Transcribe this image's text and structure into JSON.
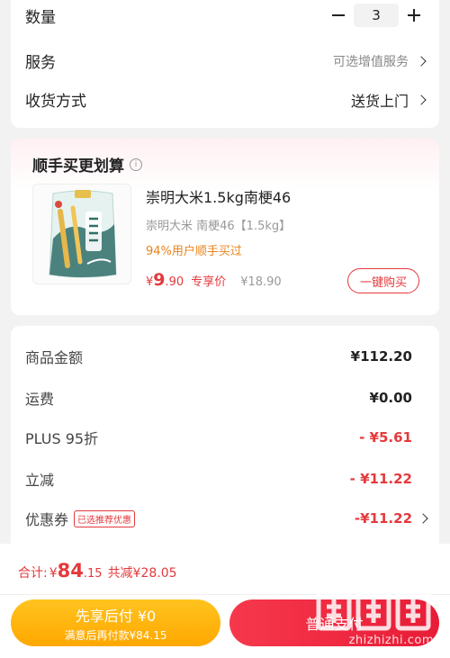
{
  "options": {
    "quantity_label": "数量",
    "quantity_value": "3",
    "service_label": "服务",
    "service_value": "可选增值服务",
    "delivery_label": "收货方式",
    "delivery_value": "送货上门"
  },
  "bundle": {
    "title": "顺手买更划算",
    "info_icon_glyph": "i",
    "product": {
      "name": "崇明大米1.5kg南梗46",
      "spec": "崇明大米 南梗46【1.5kg】",
      "tag": "94%用户顺手买过",
      "price_currency": "¥",
      "price_int": "9",
      "price_dec": ".90",
      "price_label": "专享价",
      "original_price": "¥18.90",
      "buy_label": "一键购买",
      "image_icon": "rice-bag-icon"
    }
  },
  "amounts": {
    "rows": [
      {
        "label": "商品金额",
        "value": "¥112.20"
      },
      {
        "label": "运费",
        "value": "¥0.00"
      },
      {
        "label": "PLUS 95折",
        "value": "- ¥5.61"
      },
      {
        "label": "立减",
        "value": "- ¥11.22"
      },
      {
        "label": "优惠券",
        "value": "-¥11.22"
      }
    ],
    "coupon_badge": "已选推荐优惠"
  },
  "bottom": {
    "total_label": "合计:",
    "total_currency": "¥",
    "total_int": "84",
    "total_dec": ".15",
    "saved_text": "共减¥28.05",
    "pay_later_main": "先享后付 ¥0",
    "pay_later_sub": "满意后再付款¥84.15",
    "pay_normal": "普通支付"
  },
  "watermark": {
    "logo_text": "值",
    "site_text": "zhizhizhi.com"
  },
  "colors": {
    "accent_red": "#e4393c",
    "orange_tag": "#e8841c",
    "pay_later_yellow": "#ffb400",
    "pay_red": "#ef2a40"
  }
}
